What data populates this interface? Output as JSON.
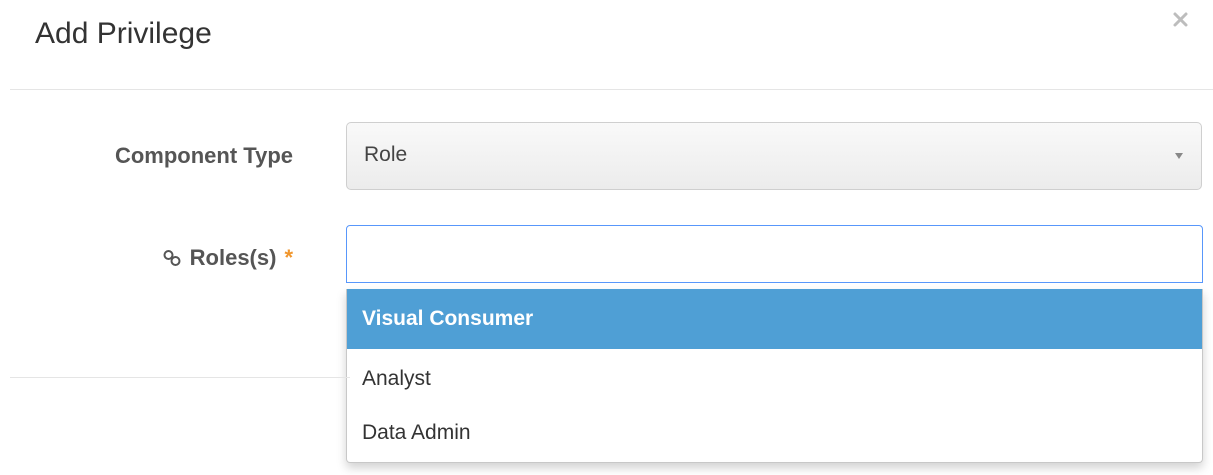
{
  "dialog": {
    "title": "Add Privilege",
    "close_label": "×"
  },
  "form": {
    "component_type": {
      "label": "Component Type",
      "selected_value": "Role"
    },
    "roles": {
      "label": "Roles(s)",
      "required_marker": "*",
      "value": "",
      "options": [
        "Visual Consumer",
        "Analyst",
        "Data Admin"
      ],
      "highlighted_option": "Visual Consumer"
    }
  },
  "icons": {
    "close": "close-icon",
    "roles": "link-icon",
    "dropdown": "chevron-down-icon"
  },
  "colors": {
    "highlight_bg": "#4f9fd5",
    "focus_border": "#5897fb",
    "required_star": "#f0962d"
  }
}
